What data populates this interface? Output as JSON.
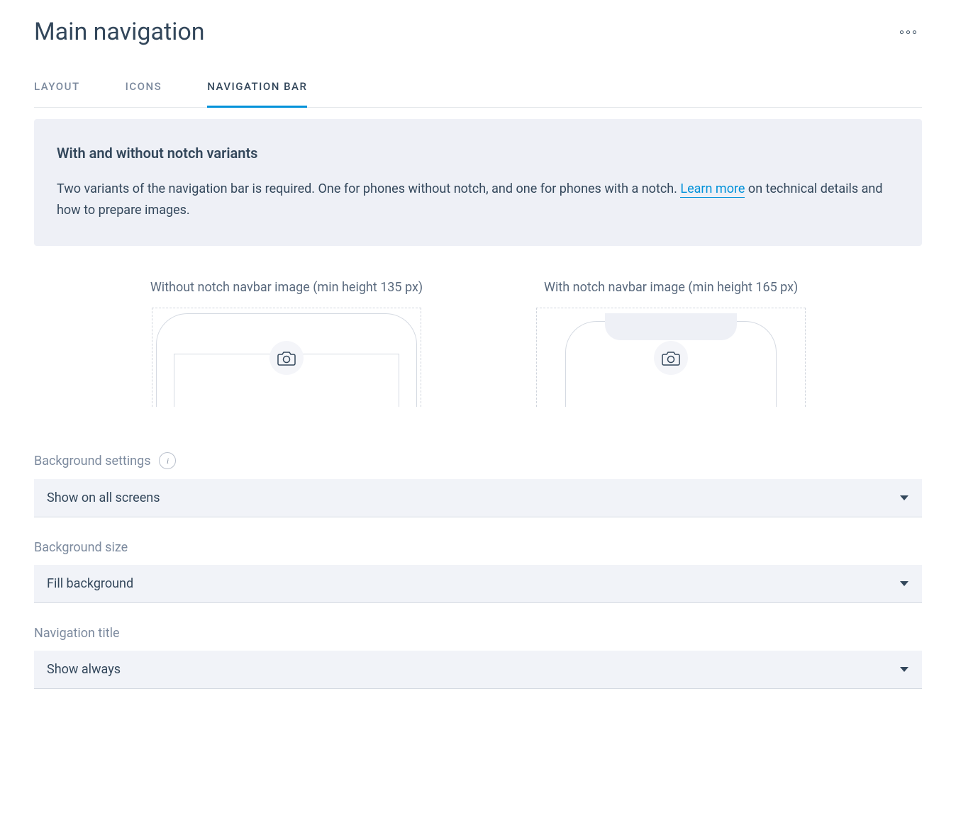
{
  "header": {
    "title": "Main navigation"
  },
  "tabs": {
    "layout": "Layout",
    "icons": "Icons",
    "navbar": "Navigation bar"
  },
  "info": {
    "title": "With and without notch variants",
    "text_part1": "Two variants of the navigation bar is required. One for phones without notch, and one for phones with a notch. ",
    "link": "Learn more",
    "text_part2": " on technical details and how to prepare images."
  },
  "uploads": {
    "without_notch_label": "Without notch navbar image (min height 135 px)",
    "with_notch_label": "With notch navbar image (min height 165 px)"
  },
  "fields": {
    "bg_settings": {
      "label": "Background settings",
      "value": "Show on all screens"
    },
    "bg_size": {
      "label": "Background size",
      "value": "Fill background"
    },
    "nav_title": {
      "label": "Navigation title",
      "value": "Show always"
    }
  }
}
